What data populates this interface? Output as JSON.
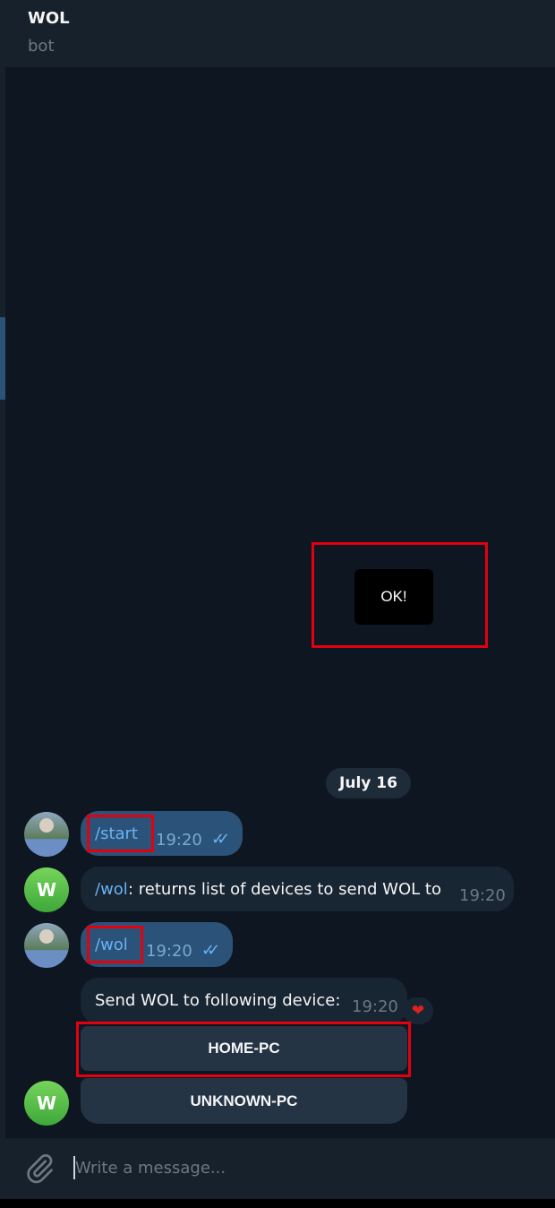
{
  "header": {
    "title": "WOL",
    "status": "bot"
  },
  "overlay": {
    "ok_label": "OK!"
  },
  "date_separator": "July 16",
  "messages": [
    {
      "command": "/start",
      "time": "19:20"
    },
    {
      "command": "/wol",
      "text": " : returns list of devices to send WOL to",
      "time": "19:20"
    },
    {
      "command": "/wol",
      "time": "19:20"
    },
    {
      "text": "Send WOL to following device:",
      "time": "19:20",
      "reaction": "heart"
    }
  ],
  "avatars": {
    "bot_initial": "W"
  },
  "keyboard": {
    "buttons": [
      "HOME-PC",
      "UNKNOWN-PC"
    ]
  },
  "composer": {
    "placeholder": "Write a message..."
  },
  "colors": {
    "background": "#0e1621",
    "outgoing": "#2b5278",
    "incoming": "#182533",
    "link": "#6ab3f3",
    "highlight": "#e3000f"
  }
}
